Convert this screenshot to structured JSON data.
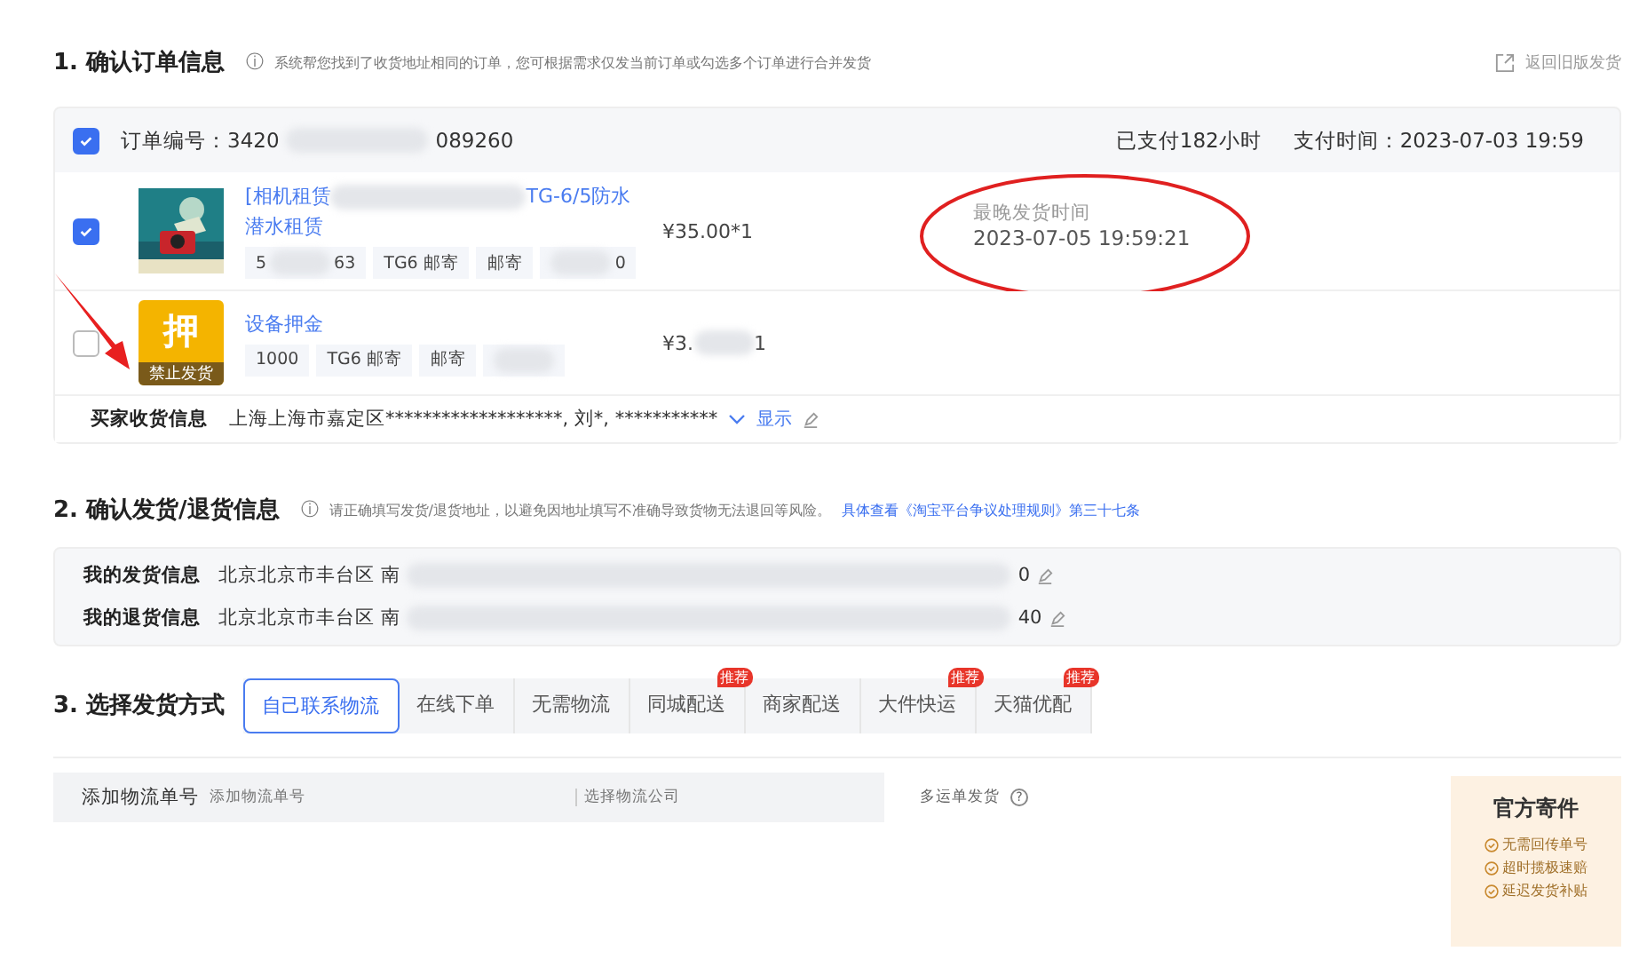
{
  "section1": {
    "title": "1. 确认订单信息",
    "info_icon": "ⓘ",
    "hint": "系统帮您找到了收货地址相同的订单，您可根据需求仅发当前订单或勾选多个订单进行合并发货",
    "back_link": "返回旧版发货"
  },
  "order": {
    "checked": true,
    "number_start": "订单编号：3420",
    "number_end": "089260",
    "paid_ago": "已支付182小时",
    "pay_time": "支付时间：2023-07-03 19:59",
    "items": [
      {
        "kind": "product",
        "checked": true,
        "title_start": "[相机租赁",
        "title_end": "TG-6/5防水",
        "title_line2": "潜水租赁",
        "tags": [
          {
            "start": "5",
            "end": "63",
            "redacted": true
          },
          {
            "start": "TG6 邮寄",
            "redacted": false
          },
          {
            "start": "邮寄",
            "redacted": false
          },
          {
            "end": "0",
            "redacted": true
          }
        ],
        "price_start": "¥35.00*1",
        "deadline_label": "最晚发货时间",
        "deadline": "2023-07-05 19:59:21"
      },
      {
        "kind": "deposit",
        "checked": false,
        "icon_char": "押",
        "icon_band": "禁止发货",
        "title_start": "设备押金",
        "tags": [
          {
            "start": "1000",
            "redacted": false
          },
          {
            "start": "TG6 邮寄",
            "redacted": false
          },
          {
            "start": "邮寄",
            "redacted": false
          },
          {
            "redacted": true
          }
        ],
        "price_start": "¥3.",
        "price_end": "1"
      }
    ],
    "buyer_label": "买家收货信息",
    "buyer_value": "上海上海市嘉定区*******************, 刘*, ***********",
    "show_link": "显示"
  },
  "section2": {
    "title": "2. 确认发货/退货信息",
    "info_icon": "ⓘ",
    "hint": "请正确填写发货/退货地址，以避免因地址填写不准确导致货物无法退回等风险。",
    "rule_link": "具体查看《淘宝平台争议处理规则》第三十七条",
    "rows": [
      {
        "label": "我的发货信息",
        "start": "北京北京市丰台区 南",
        "end": "0"
      },
      {
        "label": "我的退货信息",
        "start": "北京北京市丰台区 南",
        "end": "40"
      }
    ]
  },
  "section3": {
    "title": "3. 选择发货方式",
    "tabs": [
      {
        "label": "自己联系物流",
        "selected": true
      },
      {
        "label": "在线下单",
        "selected": false
      },
      {
        "label": "无需物流",
        "selected": false
      },
      {
        "label": "同城配送",
        "selected": false,
        "badge": "推荐"
      },
      {
        "label": "商家配送",
        "selected": false
      },
      {
        "label": "大件快运",
        "selected": false,
        "badge": "推荐"
      },
      {
        "label": "天猫优配",
        "selected": false,
        "badge": "推荐"
      }
    ],
    "tracking_label": "添加物流单号",
    "tracking_placeholder": "添加物流单号",
    "company_placeholder": "选择物流公司",
    "multi_label": "多运单发货",
    "help_icon": "?",
    "official": {
      "title": "官方寄件",
      "features": [
        "无需回传单号",
        "超时揽极速赔",
        "延迟发货补贴"
      ]
    }
  }
}
